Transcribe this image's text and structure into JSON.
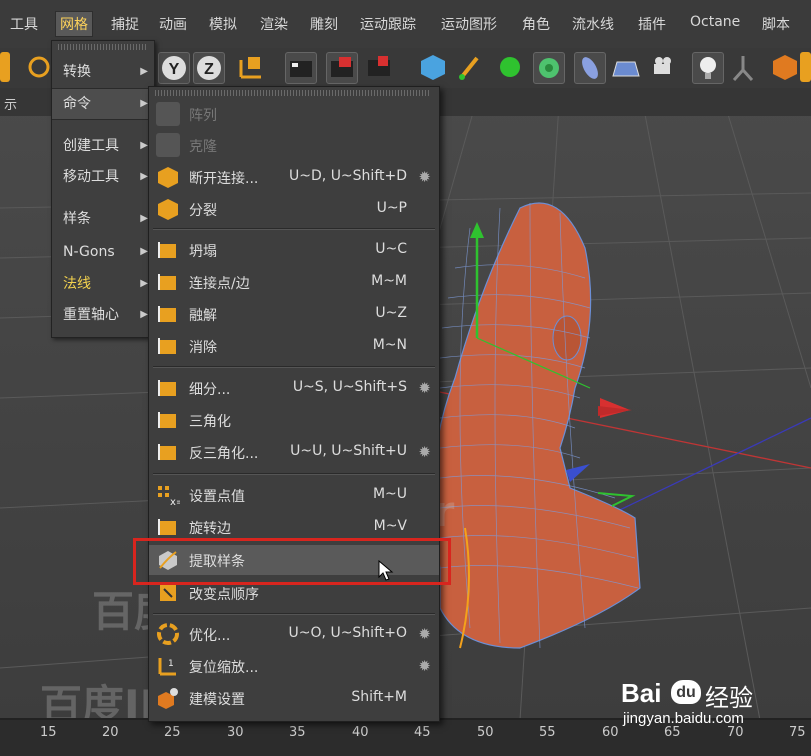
{
  "menubar": {
    "items": [
      "工具",
      "网格",
      "捕捉",
      "动画",
      "模拟",
      "渲染",
      "雕刻",
      "运动跟踪",
      "运动图形",
      "角色",
      "流水线",
      "插件",
      "Octane",
      "脚本"
    ],
    "active_index": 1
  },
  "viewport": {
    "label": "示"
  },
  "submenu": {
    "items": [
      {
        "label": "转换",
        "arrow": "▶"
      },
      {
        "label": "命令",
        "arrow": "▶"
      },
      {
        "label": "创建工具",
        "arrow": "▶"
      },
      {
        "label": "移动工具",
        "arrow": "▶"
      },
      {
        "label": "样条",
        "arrow": "▶"
      },
      {
        "label": "N-Gons",
        "arrow": "▶"
      },
      {
        "label": "法线",
        "arrow": "▶"
      },
      {
        "label": "重置轴心",
        "arrow": "▶"
      }
    ]
  },
  "command_menu": {
    "items": [
      {
        "label": "阵列",
        "shortcut": "",
        "gear": false,
        "disabled": true
      },
      {
        "label": "克隆",
        "shortcut": "",
        "gear": false,
        "disabled": true
      },
      {
        "label": "断开连接...",
        "shortcut": "U~D, U~Shift+D",
        "gear": true
      },
      {
        "label": "分裂",
        "shortcut": "U~P",
        "gear": false
      },
      {
        "label": "坍塌",
        "shortcut": "U~C",
        "gear": false
      },
      {
        "label": "连接点/边",
        "shortcut": "M~M",
        "gear": false
      },
      {
        "label": "融解",
        "shortcut": "U~Z",
        "gear": false
      },
      {
        "label": "消除",
        "shortcut": "M~N",
        "gear": false
      },
      {
        "label": "细分...",
        "shortcut": "U~S, U~Shift+S",
        "gear": true
      },
      {
        "label": "三角化",
        "shortcut": "",
        "gear": false
      },
      {
        "label": "反三角化...",
        "shortcut": "U~U, U~Shift+U",
        "gear": true
      },
      {
        "label": "设置点值",
        "shortcut": "M~U",
        "gear": false
      },
      {
        "label": "旋转边",
        "shortcut": "M~V",
        "gear": false
      },
      {
        "label": "提取样条",
        "shortcut": "",
        "gear": false,
        "hover": true
      },
      {
        "label": "改变点顺序",
        "shortcut": "",
        "gear": false
      },
      {
        "label": "优化...",
        "shortcut": "U~O, U~Shift+O",
        "gear": true
      },
      {
        "label": "复位缩放...",
        "shortcut": "",
        "gear": true
      },
      {
        "label": "建模设置",
        "shortcut": "Shift+M",
        "gear": false
      }
    ],
    "gear_glyph": "✹"
  },
  "timeline": {
    "ticks": [
      "15",
      "20",
      "25",
      "30",
      "35",
      "40",
      "45",
      "50",
      "55",
      "60",
      "65",
      "70",
      "75"
    ]
  },
  "watermark": {
    "text_a": "百度ID: ffjczr",
    "baidu_logo": "Bai",
    "baidu_logo_du": "du",
    "baidu_logo_suffix": "经验",
    "baidu_url": "jingyan.baidu.com"
  },
  "colors": {
    "accent_yellow": "#f3d24e",
    "highlight_red": "#d8251e",
    "head_orange": "#c8603f",
    "wire_blue": "#6c8fd6"
  }
}
